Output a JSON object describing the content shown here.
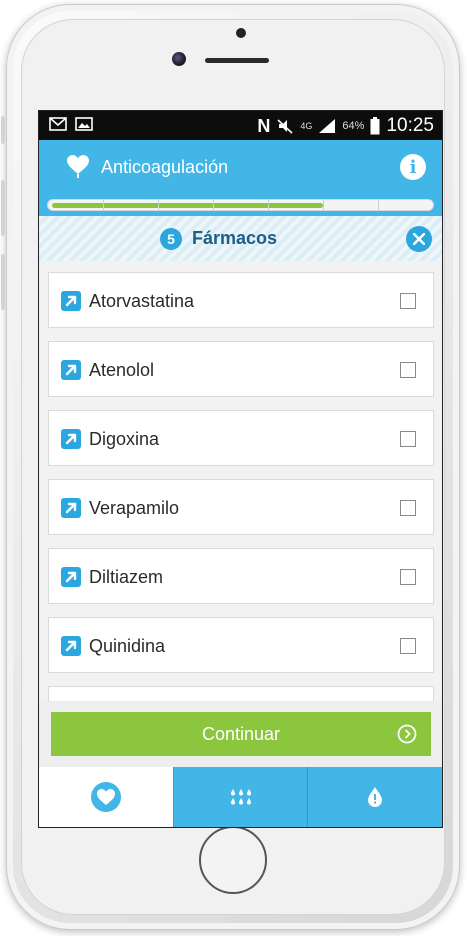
{
  "app": {
    "title": "Anticoagulación"
  },
  "status_bar": {
    "time": "10:25",
    "battery": "64%",
    "network": "4G",
    "carrier_glyph": "N"
  },
  "progress": {
    "value": 0.72,
    "segments": 7
  },
  "section": {
    "number": "5",
    "title": "Fármacos"
  },
  "items": [
    {
      "label": "Atorvastatina",
      "checked": false
    },
    {
      "label": "Atenolol",
      "checked": false
    },
    {
      "label": "Digoxina",
      "checked": false
    },
    {
      "label": "Verapamilo",
      "checked": false
    },
    {
      "label": "Diltiazem",
      "checked": false
    },
    {
      "label": "Quinidina",
      "checked": false
    }
  ],
  "continue_button": {
    "label": "Continuar"
  },
  "tabs": [
    {
      "icon": "heart-icon",
      "active": true
    },
    {
      "icon": "drops-icon",
      "active": false
    },
    {
      "icon": "drop-icon",
      "active": false
    }
  ],
  "colors": {
    "primary": "#42b6e7",
    "accent_green": "#8cc63f",
    "section_text": "#1a5f86"
  }
}
